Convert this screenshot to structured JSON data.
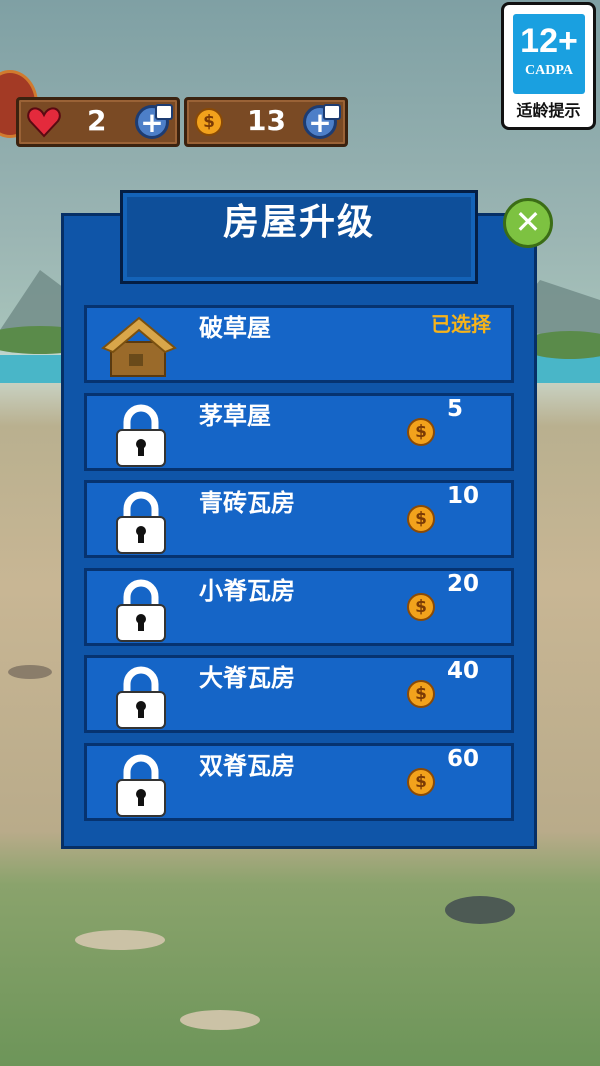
{
  "hud": {
    "lives": "2",
    "coins": "13",
    "lives_icon": "heart-icon",
    "coin_icon": "coin-icon",
    "plus_label": "+"
  },
  "age_rating": {
    "number": "12+",
    "org": "CADPA",
    "tip": "适龄提示"
  },
  "dialog": {
    "title": "房屋升级",
    "close_icon": "close-icon",
    "close_glyph": "✕",
    "items": [
      {
        "name": "破草屋",
        "status": "已选择",
        "icon": "straw-hut-icon"
      },
      {
        "name": "茅草屋",
        "price": "5",
        "icon": "lock-icon"
      },
      {
        "name": "青砖瓦房",
        "price": "10",
        "icon": "lock-icon"
      },
      {
        "name": "小脊瓦房",
        "price": "20",
        "icon": "lock-icon"
      },
      {
        "name": "大脊瓦房",
        "price": "40",
        "icon": "lock-icon"
      },
      {
        "name": "双脊瓦房",
        "price": "60",
        "icon": "lock-icon"
      }
    ]
  },
  "colors": {
    "panel": "#0f55a8",
    "row": "#1565c7",
    "selected_text": "#f7b41a",
    "close_button": "#7dc241"
  }
}
